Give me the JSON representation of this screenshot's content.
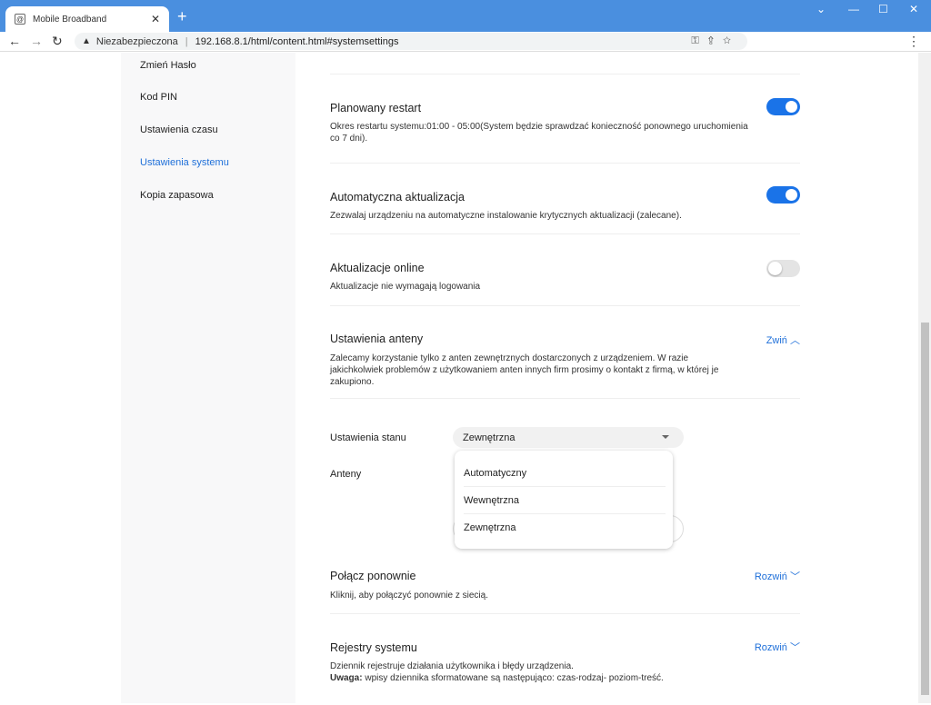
{
  "browser": {
    "tab_title": "Mobile Broadband",
    "security": "Niezabezpieczona",
    "url": "192.168.8.1/html/content.html#systemsettings"
  },
  "sidebar": {
    "items": [
      {
        "label": "Zmień Hasło"
      },
      {
        "label": "Kod PIN"
      },
      {
        "label": "Ustawienia czasu"
      },
      {
        "label": "Ustawienia systemu",
        "active": true
      },
      {
        "label": "Kopia zapasowa"
      }
    ]
  },
  "settings": {
    "restart": {
      "title": "Planowany restart",
      "desc": "Okres restartu systemu:01:00 - 05:00(System będzie sprawdzać konieczność ponownego uruchomienia co 7 dni).",
      "enabled": true
    },
    "auto_update": {
      "title": "Automatyczna aktualizacja",
      "desc": "Zezwalaj urządzeniu na automatyczne instalowanie krytycznych aktualizacji (zalecane).",
      "enabled": true
    },
    "online_update": {
      "title": "Aktualizacje online",
      "desc": "Aktualizacje nie wymagają logowania",
      "enabled": false
    },
    "antenna": {
      "title": "Ustawienia anteny",
      "desc": "Zalecamy korzystanie tylko z anten zewnętrznych dostarczonych z urządzeniem. W razie jakichkolwiek problemów z użytkowaniem anten innych firm prosimy o kontakt z firmą, w której je zakupiono.",
      "toggle": "Zwiń",
      "state_label": "Ustawienia stanu",
      "state_value": "Zewnętrzna",
      "antennas_label": "Anteny",
      "options": [
        "Automatyczny",
        "Wewnętrzna",
        "Zewnętrzna"
      ]
    },
    "reconnect": {
      "title": "Połącz ponownie",
      "desc": "Kliknij, aby połączyć ponownie z siecią.",
      "toggle": "Rozwiń"
    },
    "logs": {
      "title": "Rejestry systemu",
      "desc": "Dziennik rejestruje działania użytkownika i błędy urządzenia.",
      "note_label": "Uwaga:",
      "note": " wpisy dziennika sformatowane są następująco: czas-rodzaj- poziom-treść.",
      "toggle": "Rozwiń"
    }
  },
  "colors": {
    "accent": "#1a73e8",
    "chrome": "#4a8fdf"
  }
}
